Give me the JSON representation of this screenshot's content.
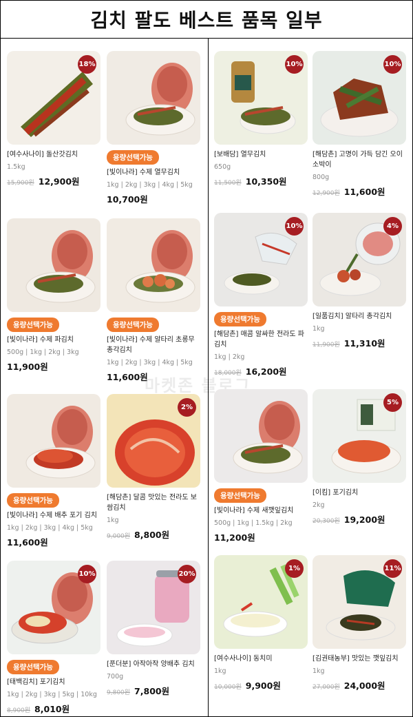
{
  "title": "김치 팔도 베스트 품목 일부",
  "watermark": "마켓존 블로그",
  "option_label": "용량선택가능",
  "products": [
    {
      "name": "[여수사나이] 돌산갓김치",
      "weight": "1.5kg",
      "original_price": "15,900원",
      "price": "12,900원",
      "discount": "18%",
      "image": "stacked-mustard-kimchi",
      "bg": "#f3efe8"
    },
    {
      "name": "[빛이나라] 수제 열무김치",
      "weight": "1kg | 2kg | 3kg | 4kg | 5kg",
      "price": "10,700원",
      "image": "yeolmu-bag-and-plate",
      "bg": "#f0ebe4"
    },
    {
      "name": "[빛이나라] 수제 파김치",
      "weight": "500g | 1kg | 2kg | 3kg",
      "price": "11,900원",
      "image": "green-onion-bag-and-plate",
      "bg": "#efe9e1"
    },
    {
      "name": "[빛이나라] 수제 알타리 초롱무 총각김치",
      "weight": "1kg | 2kg | 3kg | 4kg | 5kg",
      "price": "11,600원",
      "image": "radish-bag-and-plate",
      "bg": "#f1ebe3"
    },
    {
      "name": "[빛이나라] 수제 배추 포기 김치",
      "weight": "1kg | 2kg | 3kg | 4kg | 5kg",
      "price": "11,600원",
      "image": "cabbage-bag-and-plate",
      "bg": "#f0eae2"
    },
    {
      "name": "[해담촌] 달콤 맛있는 전라도 보쌈김치",
      "weight": "1kg",
      "original_price": "9,000원",
      "price": "8,800원",
      "discount": "2%",
      "image": "bossam-kimchi-plate",
      "bg": "#f3e4b8"
    },
    {
      "name": "[태백김치] 포기김치",
      "weight": "1kg | 2kg | 3kg | 5kg | 10kg",
      "original_price": "8,900원",
      "price": "8,010원",
      "discount": "10%",
      "image": "pogi-kimchi-bag-and-plate",
      "bg": "#eef1ee"
    },
    {
      "name": "[푼더분] 아작아작 양배추 김치",
      "weight": "700g",
      "original_price": "9,800원",
      "price": "7,800원",
      "discount": "20%",
      "image": "cabbage-jar-and-bowl",
      "bg": "#ece8ea"
    },
    {
      "name": "[보배담] 열무김치",
      "weight": "650g",
      "original_price": "11,500원",
      "price": "10,350원",
      "discount": "10%",
      "image": "jar-and-yeolmu-dish",
      "bg": "#eef0e2"
    },
    {
      "name": "[해담촌] 고명이 가득 담긴 오이소박이",
      "weight": "800g",
      "original_price": "12,900원",
      "price": "11,600원",
      "discount": "10%",
      "image": "cucumber-kimchi-plate",
      "bg": "#e7ece7"
    },
    {
      "name": "[해담촌] 매콤 알싸한 전라도 파김치",
      "weight": "1kg | 2kg",
      "original_price": "18,000원",
      "price": "16,200원",
      "discount": "10%",
      "image": "pa-kimchi-bag-and-dish",
      "bg": "#e9e8e6"
    },
    {
      "name": "[일품김치] 알타리 총각김치",
      "weight": "1kg",
      "original_price": "11,900원",
      "price": "11,310원",
      "discount": "4%",
      "image": "altari-bag-and-plate",
      "bg": "#ebe8e3"
    },
    {
      "name": "[빛이나라] 수제 새깻잎김치",
      "weight": "500g | 1kg | 1.5kg | 2kg",
      "price": "11,200원",
      "image": "perilla-bag-and-plate",
      "bg": "#eceaea"
    },
    {
      "name": "[이킴] 포기김치",
      "weight": "2kg",
      "original_price": "20,300원",
      "price": "19,200원",
      "discount": "5%",
      "image": "box-and-cabbage-plate",
      "bg": "#eef0ec"
    },
    {
      "name": "[여수사나이] 동치미",
      "weight": "1kg",
      "original_price": "10,000원",
      "price": "9,900원",
      "discount": "1%",
      "image": "dongchimi-bowl",
      "bg": "#e9efd5"
    },
    {
      "name": "[김권태농부] 맛있는 깻잎김치",
      "weight": "1kg",
      "original_price": "27,000원",
      "price": "24,000원",
      "discount": "11%",
      "image": "green-bag-perilla-kimchi",
      "bg": "#f1ece4"
    }
  ]
}
